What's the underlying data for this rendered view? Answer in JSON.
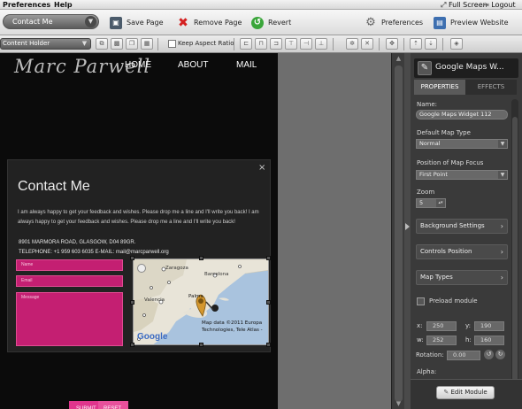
{
  "menubar": {
    "preferences": "Preferences",
    "help": "Help",
    "full_screen": "Full Screen",
    "logout": "Logout"
  },
  "toolbar": {
    "page_select": "Contact Me",
    "save_page": "Save Page",
    "remove_page": "Remove Page",
    "revert": "Revert",
    "preferences": "Preferences",
    "preview_website": "Preview Website"
  },
  "toolbar2": {
    "content_holder": "Content Holder",
    "keep_aspect_ratio": "Keep Aspect Ratio"
  },
  "site": {
    "logo": "Marc Parwell",
    "nav": [
      "HOME",
      "ABOUT",
      "MAIL"
    ]
  },
  "dialog": {
    "close": "×",
    "title": "Contact Me",
    "text": "I am always happy to get your feedback and wishes. Please drop me a line and I'll write you back! I am always happy to get your feedback and wishes. Please drop me a line and I'll write you back!",
    "address": "8901 MARMORA ROAD, GLASGOW, D04 89GR.",
    "contact": "TELEPHONE: +1 959 603 6035   E-MAIL: mail@marcparwell.org",
    "fields": {
      "name": "Name",
      "email": "Email",
      "message": "Message"
    },
    "submit": "SUBMIT",
    "reset": "RESET"
  },
  "map": {
    "cities": [
      "Zaragoza",
      "Barcelona",
      "Valencia",
      "Palma"
    ],
    "copyright_line1": "Map data ©2011  Europa",
    "copyright_line2": "Technologies, Tele Atlas -",
    "logo": "Google"
  },
  "panel": {
    "header_title": "Google Maps W...",
    "tabs": [
      "PROPERTIES",
      "EFFECTS"
    ],
    "name_label": "Name:",
    "name_value": "Google Maps Widget 112",
    "map_type_label": "Default Map Type",
    "map_type_value": "Normal",
    "focus_label": "Position of Map Focus",
    "focus_value": "First Point",
    "zoom_label": "Zoom",
    "zoom_value": "5",
    "sections": [
      "Background Settings",
      "Controls Position",
      "Map Types"
    ],
    "preload_label": "Preload module",
    "x_label": "x:",
    "x_value": "250",
    "y_label": "y:",
    "y_value": "190",
    "w_label": "w:",
    "w_value": "252",
    "h_label": "h:",
    "h_value": "160",
    "rotation_label": "Rotation:",
    "rotation_value": "0.00",
    "alpha_label": "Alpha:",
    "edit_module": "Edit Module"
  },
  "colors": {
    "accent_pink": "#c41f72",
    "canvas_bg": "#0b0b0b",
    "panel_bg": "#3a3a3a"
  }
}
